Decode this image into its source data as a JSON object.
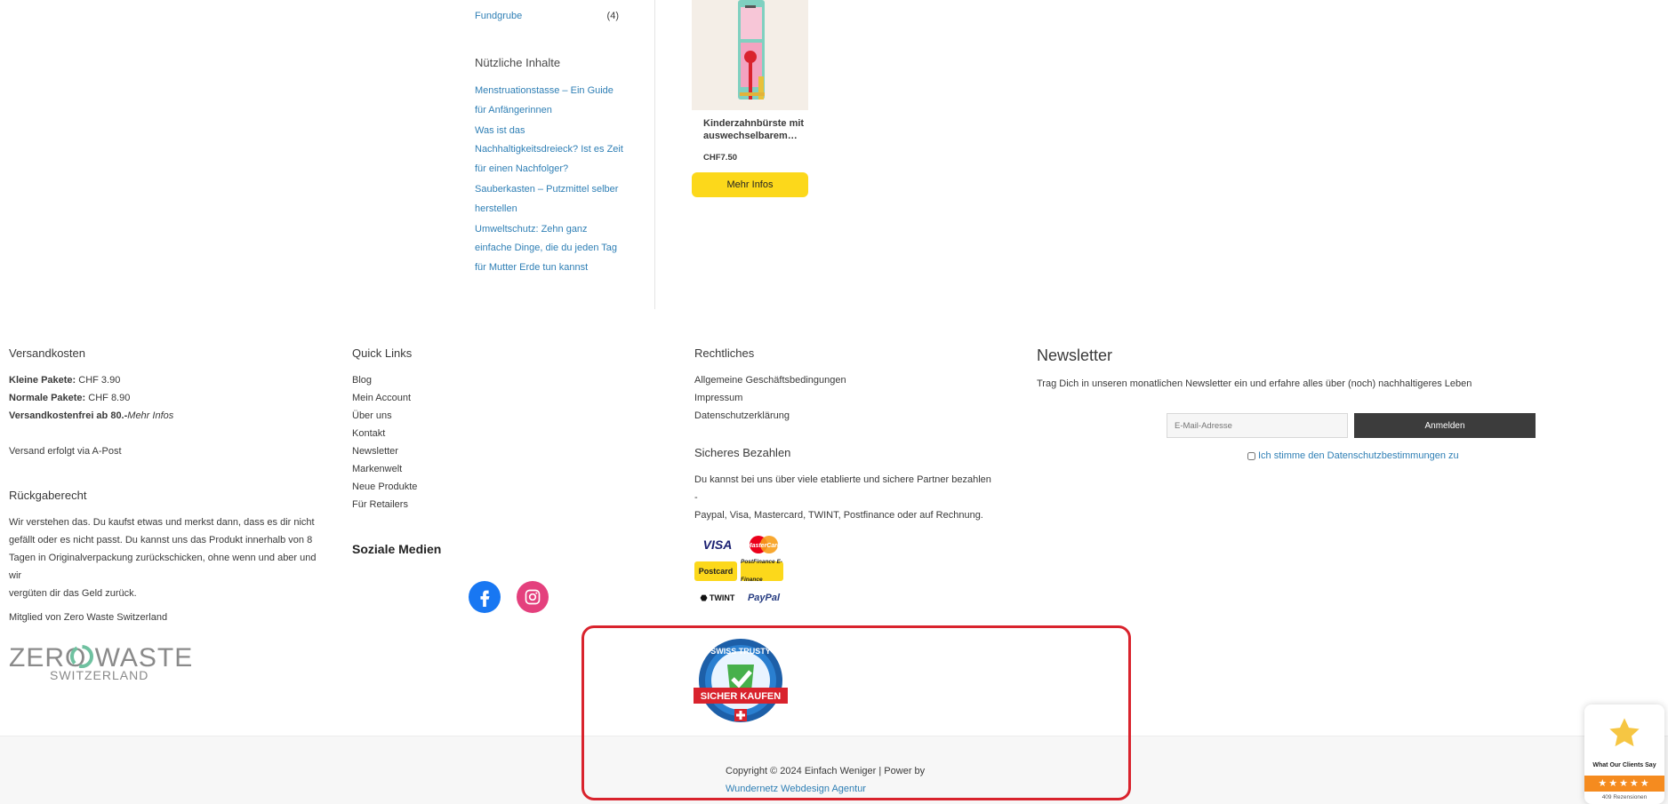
{
  "sidebar": {
    "category": {
      "label": "Fundgrube",
      "count": "(4)"
    },
    "heading": "Nützliche Inhalte",
    "posts": [
      {
        "line1": "Menstruationstasse – Ein Guide",
        "line2": "für Anfängerinnen"
      },
      {
        "line1": "Was ist das",
        "line2": "Nachhaltigkeitsdreieck? Ist es Zeit",
        "line3": "für einen Nachfolger?"
      },
      {
        "line1": "Sauberkasten – Putzmittel selber",
        "line2": "herstellen"
      },
      {
        "line1": "Umweltschutz: Zehn ganz",
        "line2": "einfache Dinge, die du jeden Tag",
        "line3": "für Mutter Erde tun kannst"
      }
    ]
  },
  "product": {
    "title_line1": "Kinderzahnbürste mit",
    "title_line2": "auswechselbarem…",
    "price": "CHF7.50",
    "button_label": "Mehr Infos"
  },
  "footer": {
    "shipping": {
      "heading": "Versandkosten",
      "small_label": "Kleine Pakete:",
      "small_value": " CHF 3.90",
      "normal_label": "Normale Pakete:",
      "normal_value": " CHF 8.90",
      "free_label": "Versandkostenfrei ab 80.-",
      "free_link": "Mehr Infos",
      "carrier": "Versand erfolgt via A-Post"
    },
    "returns": {
      "heading": "Rückgaberecht",
      "line1": "Wir verstehen das. Du kaufst etwas und merkst dann, dass es dir nicht",
      "line2": "gefällt oder es nicht passt. Du kannst uns das Produkt innerhalb von 8",
      "line3": "Tagen in Originalverpackung zurückschicken, ohne wenn und aber und wir",
      "line4": "vergüten dir das Geld zurück."
    },
    "member": {
      "text": "Mitglied von Zero Waste Switzerland",
      "logo_main": "ZERO WASTE",
      "logo_sub": "SWITZERLAND"
    },
    "quick_links": {
      "heading": "Quick Links",
      "items": [
        "Blog",
        "Mein Account",
        "Über uns",
        "Kontakt",
        "Newsletter",
        "Markenwelt",
        "Neue Produkte",
        "Für Retailers"
      ]
    },
    "social": {
      "heading": "Soziale Medien",
      "icons": [
        "facebook-icon",
        "instagram-icon"
      ]
    },
    "legal": {
      "heading": "Rechtliches",
      "items": [
        "Allgemeine Geschäftsbedingungen",
        "Impressum",
        "Datenschutzerklärung"
      ]
    },
    "payment": {
      "heading": "Sicheres Bezahlen",
      "line1": "Du kannst bei uns über viele etablierte und sichere Partner bezahlen -",
      "line2": "Paypal, Visa, Mastercard, TWINT, Postfinance oder auf Rechnung.",
      "methods": [
        "VISA",
        "MasterCard",
        "Postcard",
        "PostFinance E-Finance",
        "TWINT",
        "PayPal"
      ]
    },
    "newsletter": {
      "heading": "Newsletter",
      "text": "Trag Dich in unseren monatlichen Newsletter ein und erfahre alles über (noch) nachhaltigeres Leben",
      "email_placeholder": "E-Mail-Adresse",
      "button_label": "Anmelden",
      "consent_label": "Ich stimme den Datenschutzbestimmungen zu"
    },
    "seal": {
      "top_text": "SWISS TRUSTY",
      "banner_text": "SICHER KAUFEN"
    },
    "copyright": {
      "text": "Copyright © 2024 Einfach Weniger | Power by",
      "link": "Wundernetz Webdesign Agentur"
    }
  },
  "review_widget": {
    "label": "What Our Clients Say",
    "stars": "★★★★★",
    "count": "409 Rezensionen"
  },
  "colors": {
    "link": "#2f7fb5",
    "button_yellow": "#fcd81b",
    "button_dark": "#3c3c3c",
    "highlight_red": "#d9232d",
    "review_orange": "#f58b1f"
  }
}
